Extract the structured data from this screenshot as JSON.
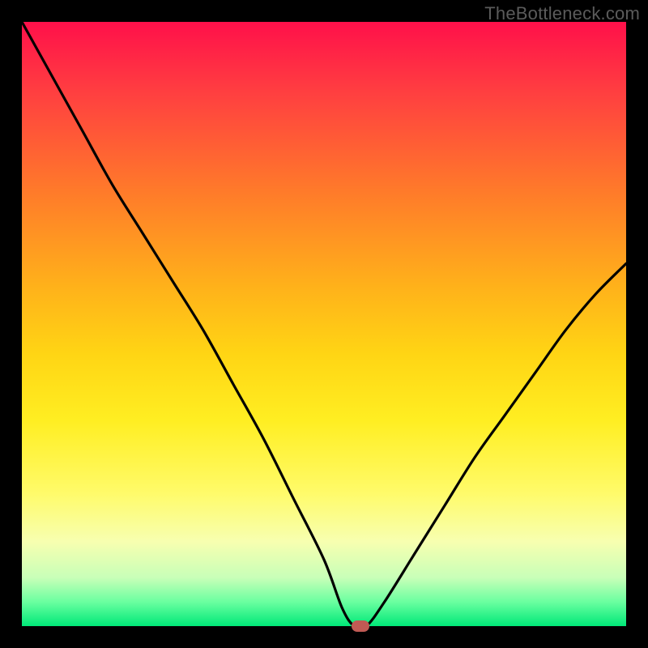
{
  "watermark": "TheBottleneck.com",
  "colors": {
    "frame": "#000000",
    "gradient_top": "#ff104a",
    "gradient_bottom": "#00e878",
    "curve": "#000000",
    "marker": "#c05a54"
  },
  "chart_data": {
    "type": "line",
    "title": "",
    "xlabel": "",
    "ylabel": "",
    "xlim": [
      0,
      100
    ],
    "ylim": [
      0,
      100
    ],
    "grid": false,
    "legend": false,
    "x": [
      0,
      5,
      10,
      15,
      20,
      25,
      30,
      35,
      40,
      45,
      50,
      53,
      55,
      57,
      60,
      65,
      70,
      75,
      80,
      85,
      90,
      95,
      100
    ],
    "values": [
      100,
      91,
      82,
      73,
      65,
      57,
      49,
      40,
      31,
      21,
      11,
      3,
      0,
      0,
      4,
      12,
      20,
      28,
      35,
      42,
      49,
      55,
      60
    ],
    "marker": {
      "x": 56,
      "y": 0
    },
    "note": "values interpreted as percent of plot height from bottom (0 = bottom green band, 100 = top)"
  }
}
